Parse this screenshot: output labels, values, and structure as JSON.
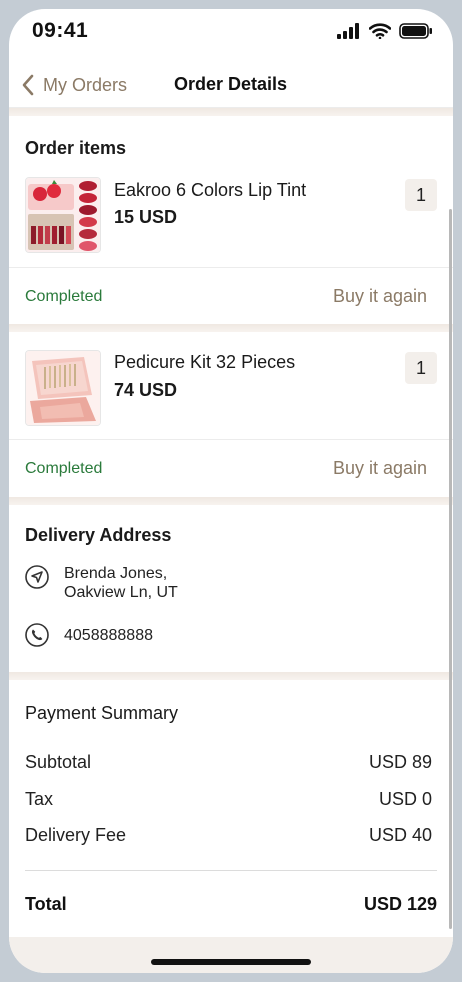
{
  "status_bar": {
    "time": "09:41",
    "icons": [
      "signal-icon",
      "wifi-icon",
      "battery-icon"
    ]
  },
  "nav": {
    "back_label": "My Orders",
    "title": "Order Details"
  },
  "order_items": {
    "title": "Order items",
    "items": [
      {
        "name": "Eakroo 6 Colors Lip Tint",
        "price": "15 USD",
        "quantity": "1",
        "status": "Completed",
        "action": "Buy it again"
      },
      {
        "name": "Pedicure Kit 32 Pieces",
        "price": "74 USD",
        "quantity": "1",
        "status": "Completed",
        "action": "Buy it again"
      }
    ]
  },
  "delivery": {
    "title": "Delivery Address",
    "name": "Brenda Jones,",
    "address": "Oakview Ln, UT",
    "phone": "4058888888"
  },
  "payment": {
    "title": "Payment Summary",
    "rows": [
      {
        "label": "Subtotal",
        "value": "USD 89"
      },
      {
        "label": "Tax",
        "value": "USD 0"
      },
      {
        "label": "Delivery Fee",
        "value": "USD 40"
      }
    ],
    "total_label": "Total",
    "total_value": "USD 129"
  },
  "colors": {
    "accent": "#8b7a66",
    "completed": "#2a7a3b",
    "band": "#f3efeb"
  }
}
